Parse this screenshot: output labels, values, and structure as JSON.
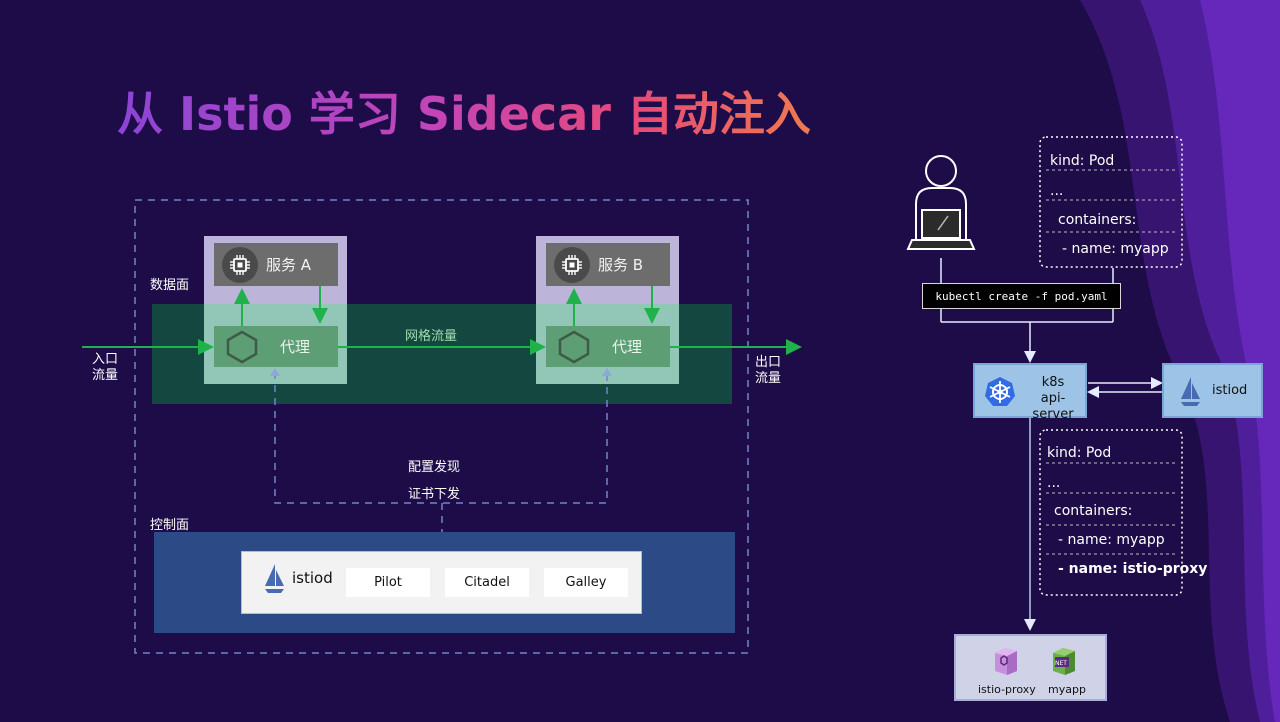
{
  "title": "从 Istio 学习 Sidecar 自动注入",
  "data_plane": {
    "label": "数据面",
    "service_a": "服务 A",
    "service_b": "服务 B",
    "proxy_a": "代理",
    "proxy_b": "代理",
    "mesh_traffic": "网格流量",
    "ingress": [
      "入口",
      "流量"
    ],
    "egress": [
      "出口",
      "流量"
    ]
  },
  "config": {
    "discovery": "配置发现",
    "cert": "证书下发"
  },
  "control_plane": {
    "label": "控制面",
    "istiod": "istiod",
    "components": [
      "Pilot",
      "Citadel",
      "Galley"
    ]
  },
  "right": {
    "command": "kubectl create -f pod.yaml",
    "yaml_top": [
      "kind: Pod",
      "...",
      "containers:",
      "- name: myapp"
    ],
    "yaml_bottom": [
      "kind: Pod",
      "...",
      "containers:",
      "- name: myapp",
      "- name: istio-proxy"
    ],
    "k8s": [
      "k8s",
      "api-server"
    ],
    "istiod": "istiod",
    "pod_items": [
      "istio-proxy",
      "myapp"
    ],
    "net_badge": "NET"
  },
  "colors": {
    "background": "#1d0c47",
    "data_plane_band": "#14473f",
    "control_plane_band": "#2b4a86",
    "arrow_green": "#1fb24a",
    "node_blue": "#9dc3e6"
  }
}
